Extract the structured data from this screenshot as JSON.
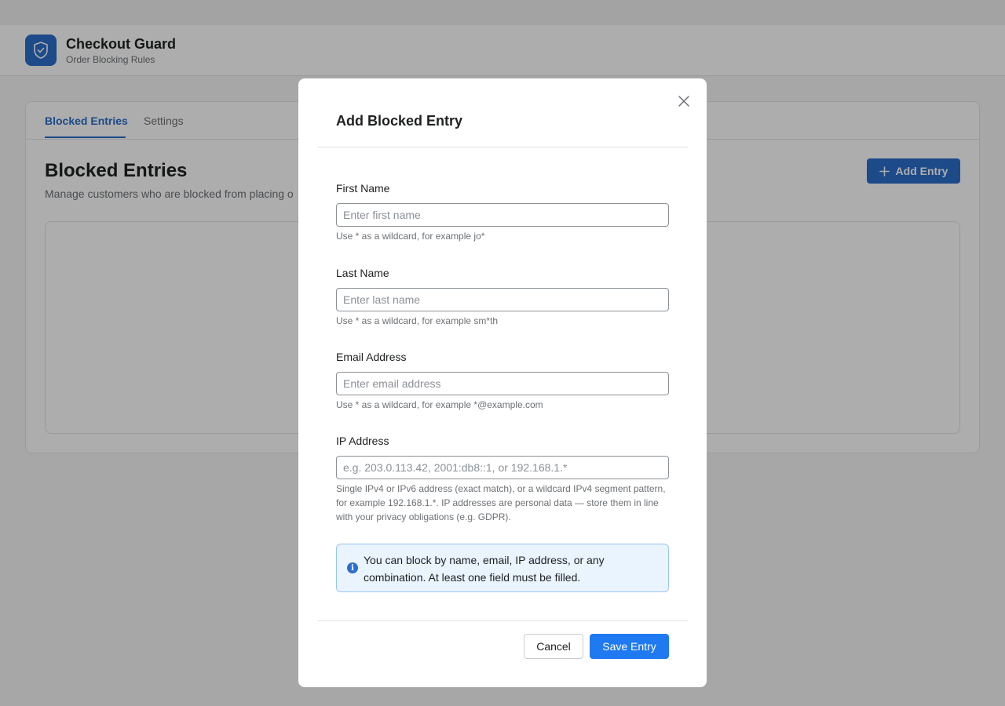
{
  "app": {
    "title": "Checkout Guard",
    "subtitle": "Order Blocking Rules",
    "logo_icon": "shield-check-icon",
    "accent_color": "#2c6ecb"
  },
  "tabs": [
    {
      "label": "Blocked Entries",
      "active": true
    },
    {
      "label": "Settings",
      "active": false
    }
  ],
  "page": {
    "title": "Blocked Entries",
    "description": "Manage customers who are blocked from placing o",
    "add_button_label": "Add Entry",
    "add_button_icon": "plus-icon"
  },
  "modal": {
    "title": "Add Blocked Entry",
    "close_icon": "close-icon",
    "fields": {
      "first_name": {
        "label": "First Name",
        "placeholder": "Enter first name",
        "value": "",
        "help": "Use * as a wildcard, for example jo*"
      },
      "last_name": {
        "label": "Last Name",
        "placeholder": "Enter last name",
        "value": "",
        "help": "Use * as a wildcard, for example sm*th"
      },
      "email": {
        "label": "Email Address",
        "placeholder": "Enter email address",
        "value": "",
        "help": "Use * as a wildcard, for example *@example.com"
      },
      "ip": {
        "label": "IP Address",
        "placeholder": "e.g. 203.0.113.42, 2001:db8::1, or 192.168.1.*",
        "value": "",
        "help": "Single IPv4 or IPv6 address (exact match), or a wildcard IPv4 segment pattern, for example 192.168.1.*. IP addresses are personal data — store them in line with your privacy obligations (e.g. GDPR)."
      }
    },
    "info": {
      "icon": "info-icon",
      "text": "You can block by name, email, IP address, or any combination. At least one field must be filled."
    },
    "cancel_label": "Cancel",
    "save_label": "Save Entry",
    "save_color": "#1f7af2"
  }
}
